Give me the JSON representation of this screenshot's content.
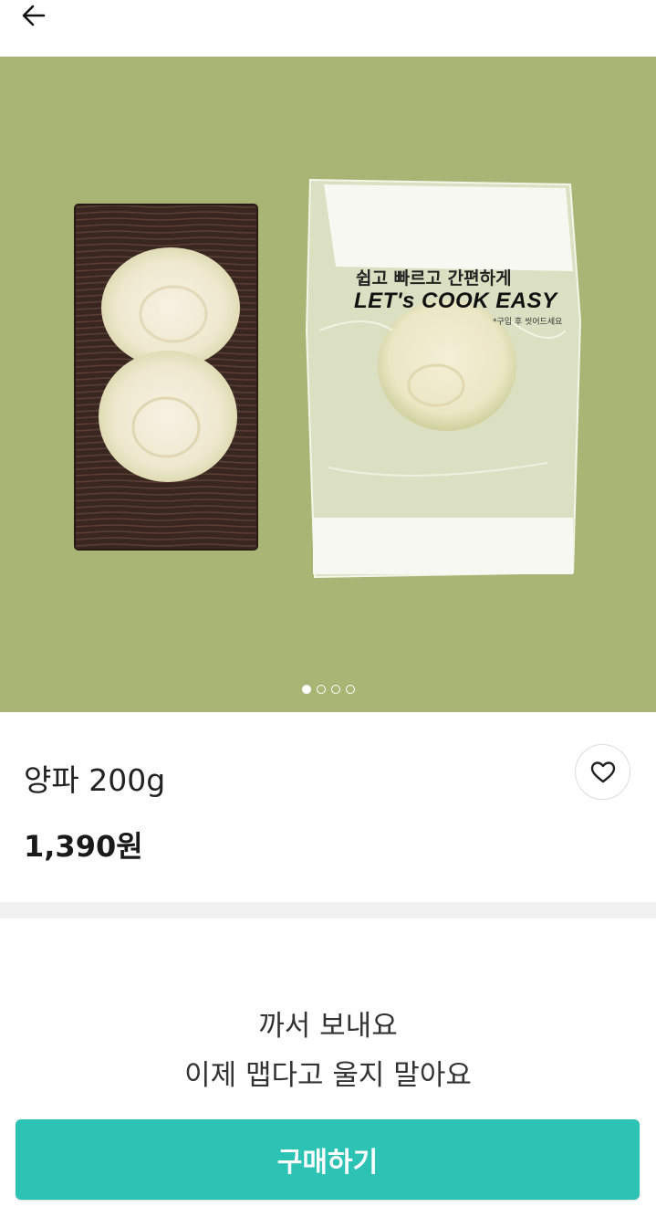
{
  "header": {
    "back_icon": "arrow-left-icon"
  },
  "hero": {
    "package_line1": "쉽고 빠르고 간편하게",
    "package_brand": "LET's COOK EASY",
    "package_note": "*구입 후 씻어드세요",
    "carousel": {
      "total": 4,
      "active_index": 0
    }
  },
  "product": {
    "name": "양파 200g",
    "price": "1,390원",
    "wishlist_icon": "heart-outline-icon"
  },
  "description": {
    "line1": "까서 보내요",
    "line2": "이제 맵다고 울지 말아요"
  },
  "actions": {
    "buy_label": "구매하기"
  },
  "colors": {
    "accent": "#2cc2b4",
    "hero_bg": "#a9b575"
  }
}
